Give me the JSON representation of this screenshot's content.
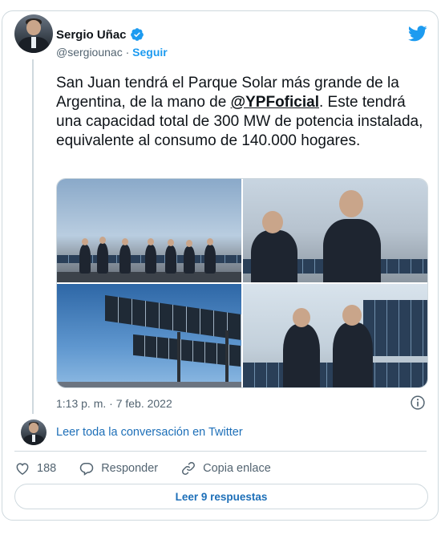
{
  "author": {
    "name": "Sergio Uñac",
    "handle": "@sergiounac",
    "separator": "·",
    "follow_label": "Seguir"
  },
  "tweet": {
    "text_before_mention": "San Juan tendrá el Parque Solar más grande de la Argentina, de la mano de ",
    "mention": "@YPFoficial",
    "text_after_mention": ". Este tendrá una capacidad total de 300 MW de potencia instalada, equivalente al consumo de 140.000 hogares."
  },
  "timestamp": "1:13 p. m. · 7 feb. 2022",
  "read_conversation": "Leer toda la conversación en Twitter",
  "actions": {
    "like_count": "188",
    "reply_label": "Responder",
    "copy_link_label": "Copia enlace"
  },
  "read_replies_label": "Leer 9 respuestas",
  "colors": {
    "accent": "#1d9bf0",
    "link": "#1d6fb8",
    "border": "#cfd9de",
    "muted": "#536471"
  },
  "icons": [
    "verified-icon",
    "twitter-bird-icon",
    "info-icon",
    "heart-icon",
    "reply-icon",
    "link-icon"
  ]
}
